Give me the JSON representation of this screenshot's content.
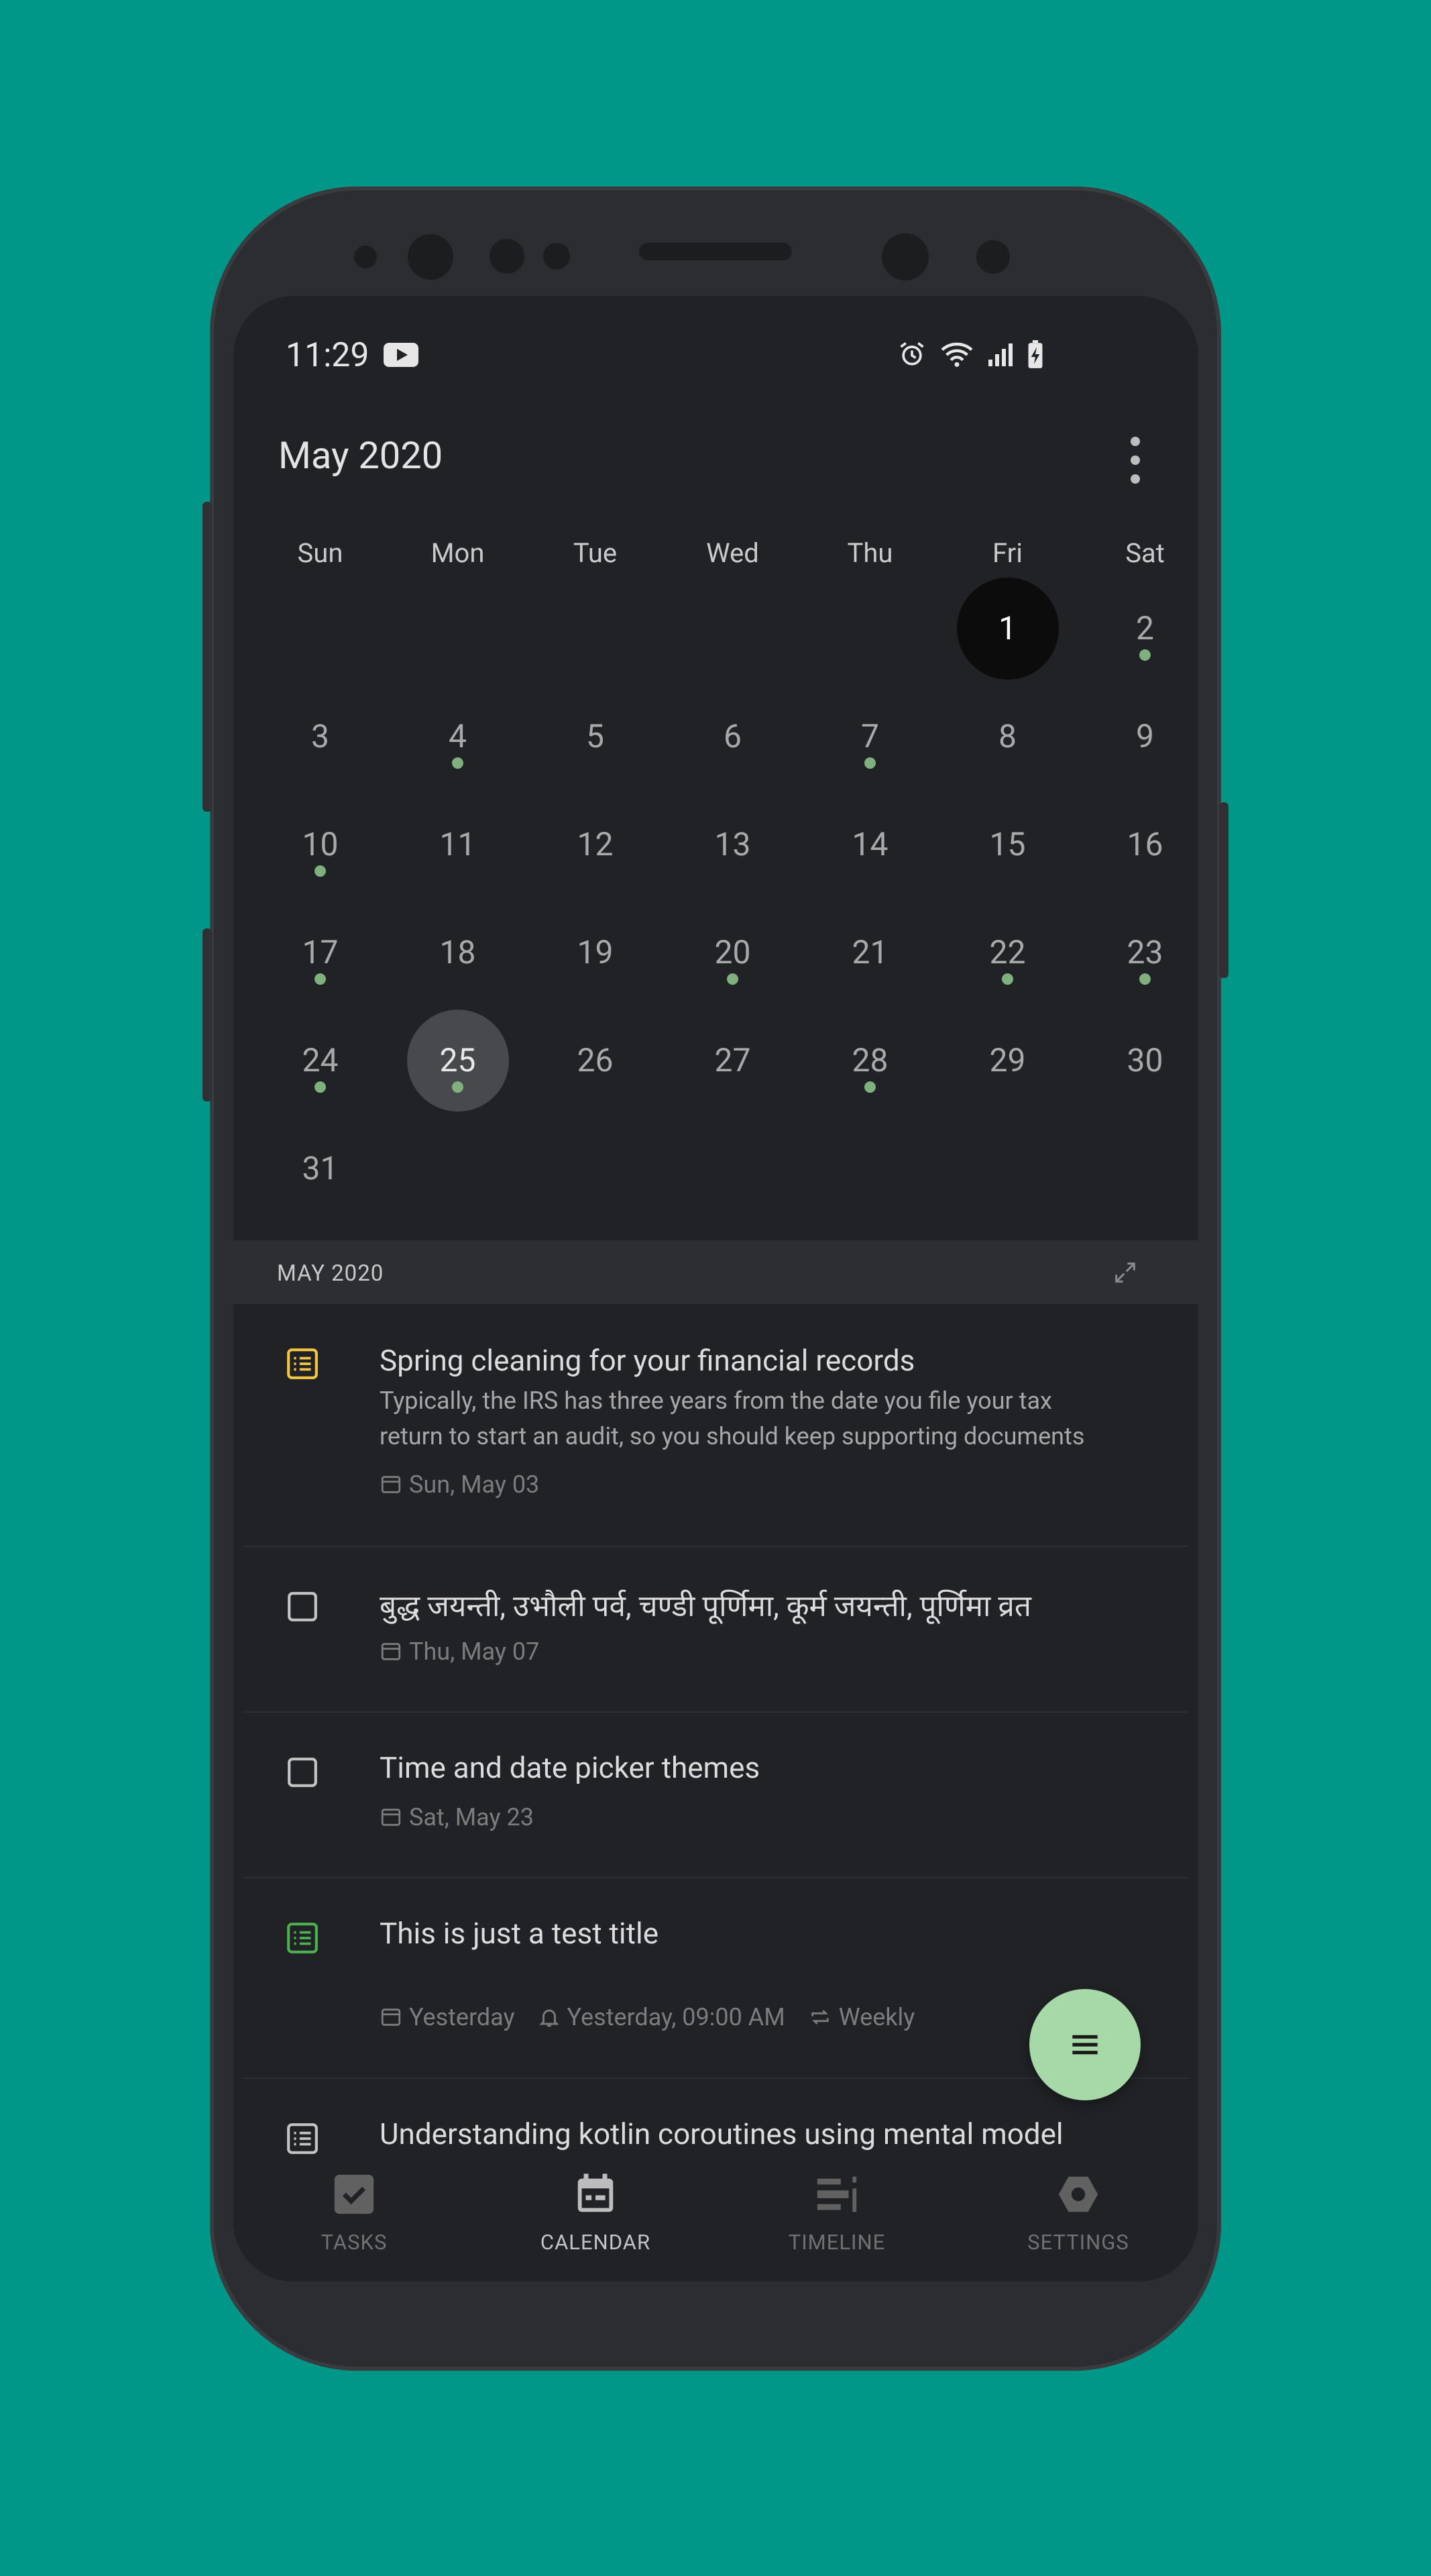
{
  "status_bar": {
    "time": "11:29"
  },
  "header": {
    "title": "May 2020"
  },
  "calendar": {
    "weekdays": [
      "Sun",
      "Mon",
      "Tue",
      "Wed",
      "Thu",
      "Fri",
      "Sat"
    ],
    "weeks": [
      [
        {
          "d": ""
        },
        {
          "d": ""
        },
        {
          "d": ""
        },
        {
          "d": ""
        },
        {
          "d": ""
        },
        {
          "d": "1",
          "sel": true
        },
        {
          "d": "2",
          "dot": true
        }
      ],
      [
        {
          "d": "3"
        },
        {
          "d": "4",
          "dot": true
        },
        {
          "d": "5"
        },
        {
          "d": "6"
        },
        {
          "d": "7",
          "dot": true
        },
        {
          "d": "8"
        },
        {
          "d": "9"
        }
      ],
      [
        {
          "d": "10",
          "dot": true
        },
        {
          "d": "11"
        },
        {
          "d": "12"
        },
        {
          "d": "13"
        },
        {
          "d": "14"
        },
        {
          "d": "15"
        },
        {
          "d": "16"
        }
      ],
      [
        {
          "d": "17",
          "dot": true
        },
        {
          "d": "18"
        },
        {
          "d": "19"
        },
        {
          "d": "20",
          "dot": true
        },
        {
          "d": "21"
        },
        {
          "d": "22",
          "dot": true
        },
        {
          "d": "23",
          "dot": true
        }
      ],
      [
        {
          "d": "24",
          "dot": true
        },
        {
          "d": "25",
          "dot": true,
          "today": true
        },
        {
          "d": "26"
        },
        {
          "d": "27"
        },
        {
          "d": "28",
          "dot": true
        },
        {
          "d": "29"
        },
        {
          "d": "30"
        }
      ],
      [
        {
          "d": "31"
        },
        {
          "d": ""
        },
        {
          "d": ""
        },
        {
          "d": ""
        },
        {
          "d": ""
        },
        {
          "d": ""
        },
        {
          "d": ""
        }
      ]
    ]
  },
  "month_bar": {
    "label": "MAY 2020"
  },
  "tasks": [
    {
      "title": "Spring cleaning for your financial records",
      "desc_line1": "Typically, the IRS has three years from the date you file your tax",
      "desc_line2": "return to start an audit, so you should keep supporting documents",
      "date": "Sun, May 03",
      "icon": "list-icon",
      "icon_color": "#f4c542"
    },
    {
      "title": "बुद्ध जयन्ती, उभौली पर्व, चण्डी पूर्णिमा, कूर्म जयन्ती, पूर्णिमा व्रत",
      "date": "Thu, May 07",
      "icon": "checkbox-icon"
    },
    {
      "title": "Time and date picker themes",
      "date": "Sat, May 23",
      "icon": "checkbox-icon"
    },
    {
      "title": "This is just a test title",
      "date": "Yesterday",
      "reminder": "Yesterday, 09:00 AM",
      "repeat": "Weekly",
      "icon": "list-icon",
      "icon_color": "#4caf50"
    },
    {
      "title": "Understanding kotlin coroutines using mental model",
      "icon": "list-icon"
    }
  ],
  "bottom_nav": {
    "tasks": "TASKS",
    "calendar": "CALENDAR",
    "timeline": "TIMELINE",
    "settings": "SETTINGS",
    "active": "calendar"
  },
  "colors": {
    "accent": "#a6d8a8",
    "event_dot": "#7fb07e",
    "background": "#009688"
  }
}
